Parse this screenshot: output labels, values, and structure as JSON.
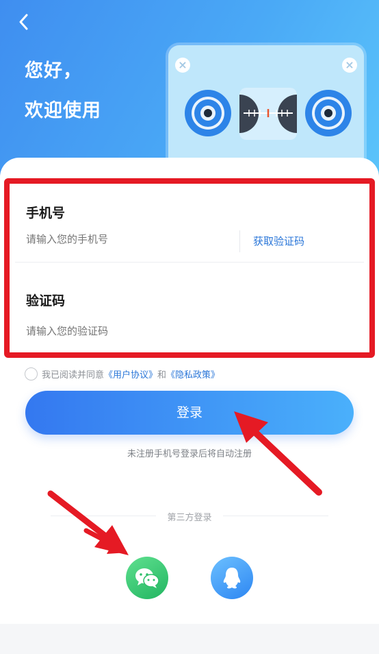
{
  "header": {
    "greeting_line1": "您好，",
    "greeting_line2": "欢迎使用"
  },
  "form": {
    "phone_label": "手机号",
    "phone_placeholder": "请输入您的手机号",
    "get_code_label": "获取验证码",
    "code_label": "验证码",
    "code_placeholder": "请输入您的验证码"
  },
  "agreement": {
    "prefix": "我已阅读并同意",
    "user_agreement": "《用户协议》",
    "and": "和",
    "privacy_policy": "《隐私政策》"
  },
  "login_button": "登录",
  "auto_register_hint": "未注册手机号登录后将自动注册",
  "third_party": {
    "title": "第三方登录",
    "options": [
      {
        "icon": "wechat-icon",
        "color": "#22b561"
      },
      {
        "icon": "qq-icon",
        "color": "#2d86f2"
      }
    ]
  },
  "colors": {
    "accent": "#3478f0",
    "link": "#2a76d8",
    "annotation_red": "#e51a24"
  }
}
